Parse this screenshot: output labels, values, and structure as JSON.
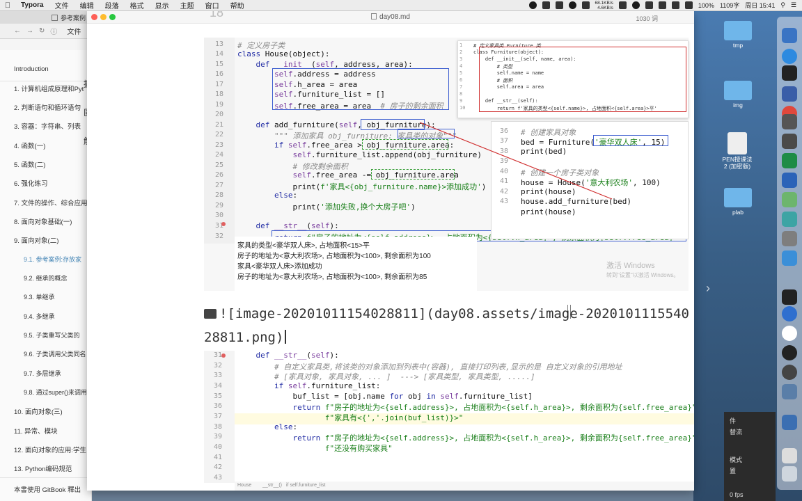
{
  "menubar": {
    "app": "Typora",
    "items": [
      "文件",
      "编辑",
      "段落",
      "格式",
      "显示",
      "主题",
      "窗口",
      "帮助"
    ],
    "net": [
      "68.1KB/s",
      "4.6KB/s"
    ],
    "battery": "100%",
    "ime": "1109字",
    "clock": "周日 15:41"
  },
  "browser": {
    "tab_title": "参考案例",
    "url": "文件",
    "side_texts": [
      "握]",
      "匿]",
      "解]"
    ],
    "toc": [
      "Introduction",
      "1. 计算机组成原理和Pyt",
      "2. 判断语句和循环语句",
      "3. 容器：字符串、列表",
      "4. 函数(一)",
      "5. 函数(二)",
      "6. 强化练习",
      "7. 文件的操作、综合应用",
      "8. 面向对象基础(一)",
      "9. 面向对象(二)",
      "9.1. 参考案例:存放家",
      "9.2. 继承的概念",
      "9.3. 单继承",
      "9.4. 多继承",
      "9.5. 子类重写父类的",
      "9.6. 子类调用父类同名",
      "9.7. 多层继承",
      "9.8. 通过super()来调用",
      "10. 面向对象(三)",
      "11. 异常、模块",
      "12. 面向对象的应用:学生",
      "13. Python编码规范"
    ],
    "footer": "本書使用 GitBook 釋出"
  },
  "desktop": {
    "icons": [
      "tmp",
      "img",
      "PEN授课法\n2 (加密版)",
      "plab"
    ],
    "panel_items": [
      "件",
      "替流",
      "模式",
      "置",
      "0 fps"
    ]
  },
  "typora": {
    "filename": "day08.md",
    "word_count": "1030 词",
    "heading_fragment": "18",
    "shot1": {
      "line_numbers": [
        "13",
        "14",
        "15",
        "16",
        "17",
        "18",
        "19",
        "20",
        "21",
        "22",
        "23",
        "24",
        "25",
        "26",
        "27",
        "28",
        "29",
        "30",
        "31",
        "32"
      ],
      "popup1_line_numbers": [
        "1",
        "2",
        "3",
        "4",
        "5",
        "6",
        "7",
        "8",
        "9",
        "10"
      ],
      "popup1_code": [
        "# 定义家具类 Furniture 类",
        "class Furniture(object):",
        "    def __init__(self, name, area):",
        "        # 类型",
        "        self.name = name",
        "        # 面积",
        "        self.area = area",
        "",
        "    def __str__(self):",
        "        return f'家具的类型<{self.name}>, 占地面积<{self.area}>平'"
      ],
      "popup2_line_numbers": [
        "36",
        "37",
        "38",
        "39",
        "40",
        "41",
        "42",
        "43"
      ],
      "console": [
        "家具的类型<豪华双人床>, 占地面积<15>平",
        "房子的地址为<意大利农场>, 占地面积为<100>, 剩余面积为100",
        "家具<豪华双人床>添加成功",
        "房子的地址为<意大利农场>, 占地面积为<100>, 剩余面积为85"
      ],
      "watermark": [
        "激活 Windows",
        "转到\"设置\"以激活 Windows。"
      ]
    },
    "md_source": {
      "line1": "![image-20201011154028811](day08.assets/image-2020101115540",
      "line2": "28811.png)"
    },
    "shot2": {
      "line_numbers": [
        "31",
        "32",
        "33",
        "34",
        "35",
        "36",
        "37",
        "38",
        "39",
        "40",
        "41",
        "42",
        "43"
      ],
      "breadcrumb": [
        "House",
        "__str__()",
        "if self.furniture_list"
      ]
    }
  },
  "colors": {
    "accent": "#4c8ab8",
    "keyword": "#1f2aa3",
    "string": "#1a7f1a"
  }
}
